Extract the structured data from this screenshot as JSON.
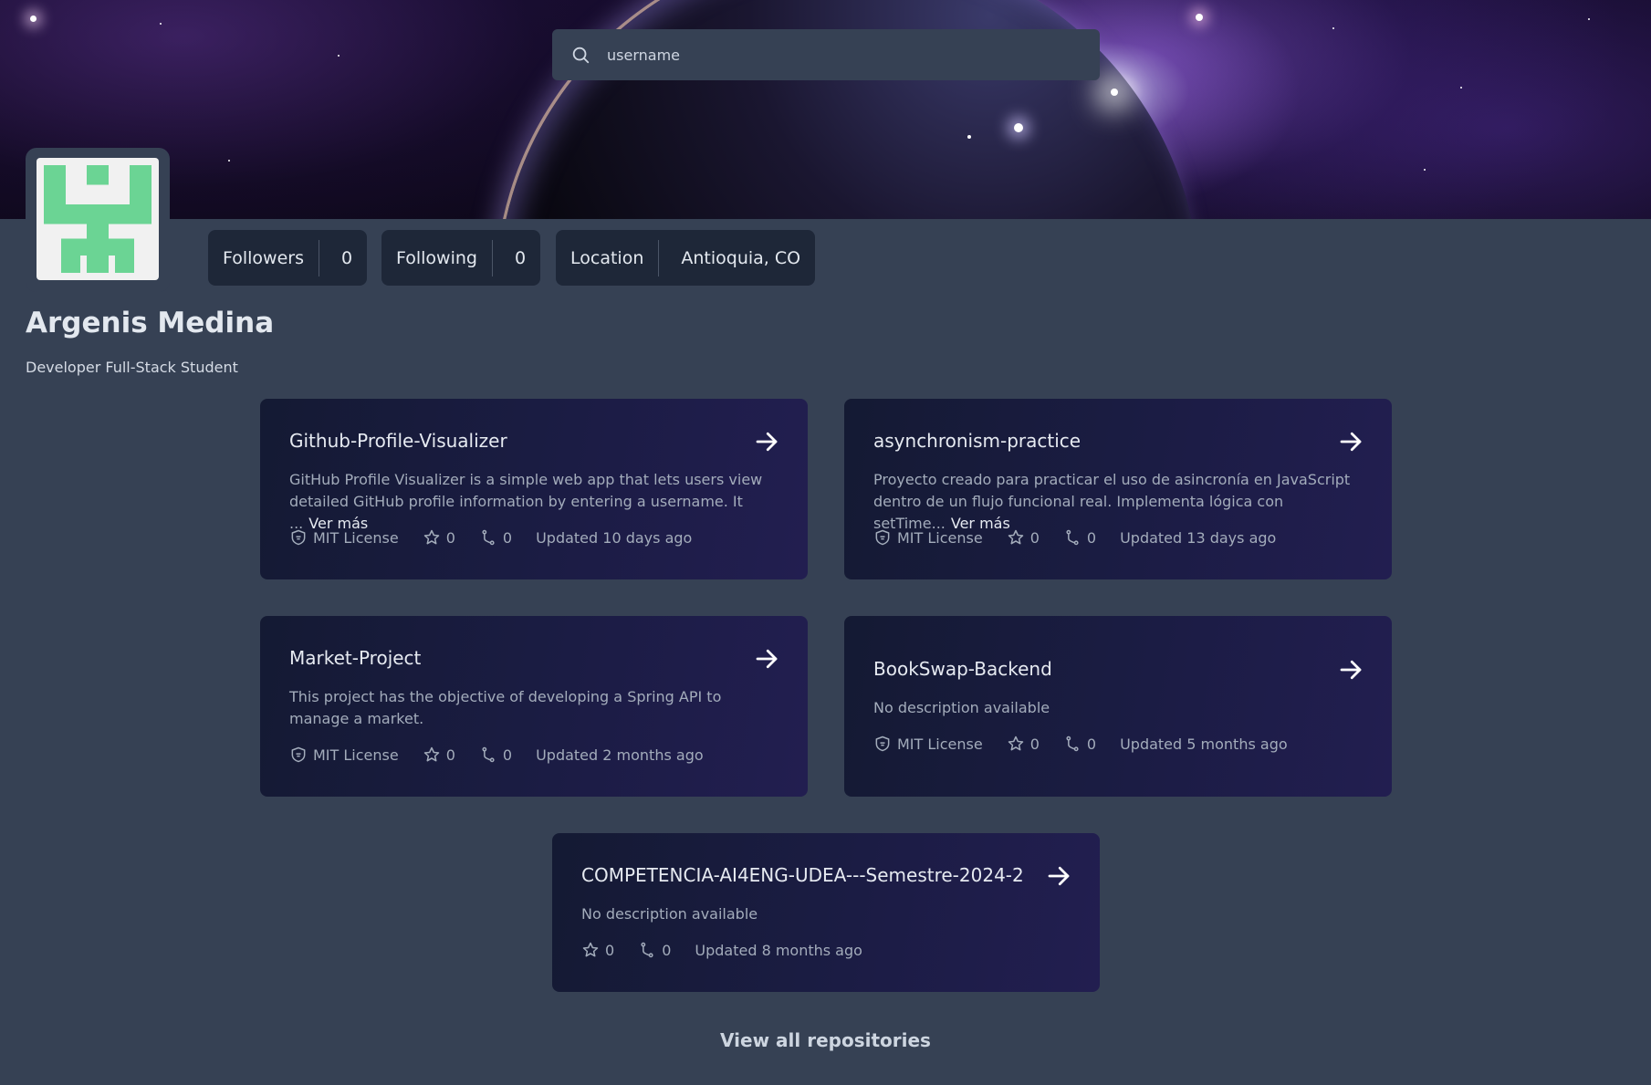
{
  "search": {
    "placeholder": "username"
  },
  "profile": {
    "name": "Argenis Medina",
    "bio": "Developer Full-Stack Student",
    "stats": [
      {
        "label": "Followers",
        "value": "0"
      },
      {
        "label": "Following",
        "value": "0"
      },
      {
        "label": "Location",
        "value": "Antioquia, CO"
      }
    ]
  },
  "repos": [
    {
      "name": "Github-Profile-Visualizer",
      "description": "GitHub Profile Visualizer is a simple web app that lets users view detailed GitHub profile information by entering a username. It ...",
      "more": "Ver más",
      "license": "MIT License",
      "stars": "0",
      "forks": "0",
      "updated": "Updated 10 days ago"
    },
    {
      "name": "asynchronism-practice",
      "description": "Proyecto creado para practicar el uso de asincronía en JavaScript dentro de un flujo funcional real. Implementa lógica con setTime...",
      "more": "Ver más",
      "license": "MIT License",
      "stars": "0",
      "forks": "0",
      "updated": "Updated 13 days ago"
    },
    {
      "name": "Market-Project",
      "description": "This project has the objective of developing a Spring API to manage a market.",
      "license": "MIT License",
      "stars": "0",
      "forks": "0",
      "updated": "Updated 2 months ago"
    },
    {
      "name": "BookSwap-Backend",
      "description": "No description available",
      "license": "MIT License",
      "stars": "0",
      "forks": "0",
      "updated": "Updated 5 months ago"
    },
    {
      "name": "COMPETENCIA-AI4ENG-UDEA---Semestre-2024-2",
      "description": "No description available",
      "stars": "0",
      "forks": "0",
      "updated": "Updated 8 months ago"
    }
  ],
  "view_all_label": "View all repositories",
  "colors": {
    "background": "#364154",
    "card": "#1b1c44",
    "stat": "#1e2738",
    "avatar_green": "#6bd494"
  }
}
